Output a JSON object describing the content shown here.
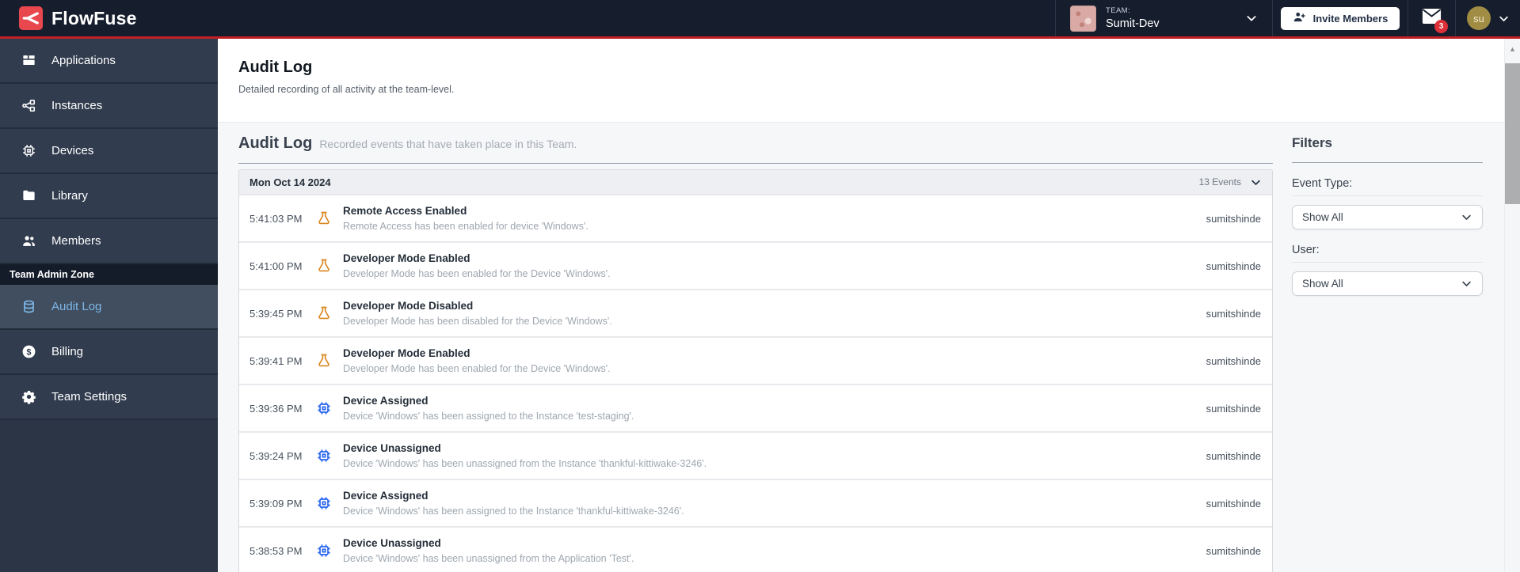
{
  "navbar": {
    "brand": "FlowFuse",
    "team": {
      "label": "TEAM:",
      "name": "Sumit-Dev"
    },
    "invite_button": "Invite Members",
    "notifications_count": "3",
    "avatar_initials": "su"
  },
  "sidebar": {
    "items": [
      {
        "label": "Applications",
        "icon": "applications"
      },
      {
        "label": "Instances",
        "icon": "instances"
      },
      {
        "label": "Devices",
        "icon": "devices"
      },
      {
        "label": "Library",
        "icon": "library"
      },
      {
        "label": "Members",
        "icon": "members"
      }
    ],
    "section_header": "Team Admin Zone",
    "admin_items": [
      {
        "label": "Audit Log",
        "icon": "audit-log",
        "active": true
      },
      {
        "label": "Billing",
        "icon": "billing"
      },
      {
        "label": "Team Settings",
        "icon": "team-settings"
      }
    ]
  },
  "page_header": {
    "title": "Audit Log",
    "subtitle": "Detailed recording of all activity at the team-level."
  },
  "main": {
    "section_title": "Audit Log",
    "section_subtitle": "Recorded events that have taken place in this Team.",
    "date_group": {
      "date": "Mon Oct 14 2024",
      "events_count": "13 Events"
    },
    "events": [
      {
        "time": "5:41:03 PM",
        "icon": "flask",
        "title": "Remote Access Enabled",
        "description": "Remote Access has been enabled for device 'Windows'.",
        "user": "sumitshinde"
      },
      {
        "time": "5:41:00 PM",
        "icon": "flask",
        "title": "Developer Mode Enabled",
        "description": "Developer Mode has been enabled for the Device 'Windows'.",
        "user": "sumitshinde"
      },
      {
        "time": "5:39:45 PM",
        "icon": "flask",
        "title": "Developer Mode Disabled",
        "description": "Developer Mode has been disabled for the Device 'Windows'.",
        "user": "sumitshinde"
      },
      {
        "time": "5:39:41 PM",
        "icon": "flask",
        "title": "Developer Mode Enabled",
        "description": "Developer Mode has been enabled for the Device 'Windows'.",
        "user": "sumitshinde"
      },
      {
        "time": "5:39:36 PM",
        "icon": "chip",
        "title": "Device Assigned",
        "description": "Device 'Windows' has been assigned to the Instance 'test-staging'.",
        "user": "sumitshinde"
      },
      {
        "time": "5:39:24 PM",
        "icon": "chip",
        "title": "Device Unassigned",
        "description": "Device 'Windows' has been unassigned from the Instance 'thankful-kittiwake-3246'.",
        "user": "sumitshinde"
      },
      {
        "time": "5:39:09 PM",
        "icon": "chip",
        "title": "Device Assigned",
        "description": "Device 'Windows' has been assigned to the Instance 'thankful-kittiwake-3246'.",
        "user": "sumitshinde"
      },
      {
        "time": "5:38:53 PM",
        "icon": "chip",
        "title": "Device Unassigned",
        "description": "Device 'Windows' has been unassigned from the Application 'Test'.",
        "user": "sumitshinde"
      }
    ]
  },
  "filters": {
    "title": "Filters",
    "event_type_label": "Event Type:",
    "event_type_value": "Show All",
    "user_label": "User:",
    "user_value": "Show All"
  },
  "colors": {
    "brand_red": "#e8484d",
    "accent_red_line": "#c32026",
    "active_item_blue": "#7db7e8",
    "flask_icon_orange": "#d9871f",
    "chip_icon_blue": "#2563eb",
    "notification_badge_red": "#dc2f38"
  }
}
